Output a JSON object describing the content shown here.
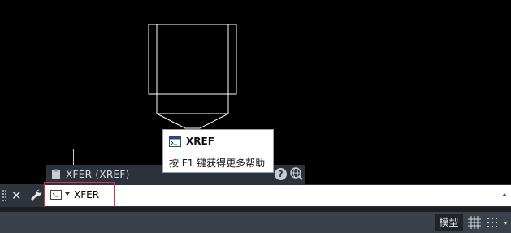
{
  "suggestion": {
    "text": "XFER (XREF)"
  },
  "tooltip": {
    "title": "XREF",
    "help_text": "按 F1 键获得更多帮助"
  },
  "command_line": {
    "value": "XFER"
  },
  "status_bar": {
    "model_tab": "模型"
  },
  "icons": {
    "clipboard": "clipboard-icon",
    "help": "help-icon",
    "globe": "globe-search-icon",
    "command": "command-prompt-icon",
    "close": "close-icon",
    "customize": "wrench-icon",
    "grid": "grid-icon",
    "snap": "snap-mode-icon"
  },
  "colors": {
    "highlight": "#d6353a",
    "viewport": "#000000",
    "drawing": "#ffffff"
  }
}
